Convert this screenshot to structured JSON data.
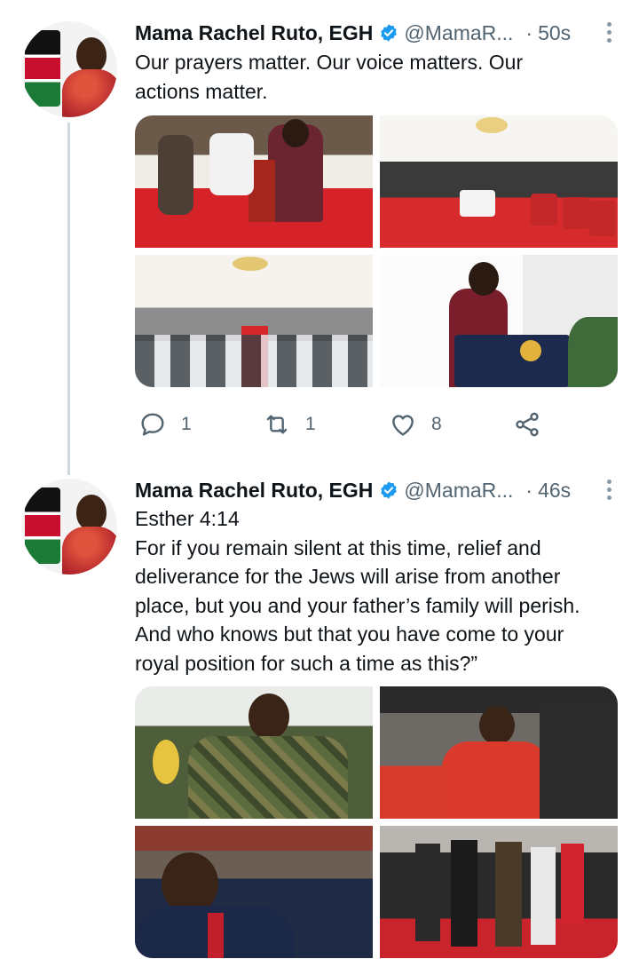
{
  "colors": {
    "verified": "#1d9bf0",
    "secondary_text": "#536471",
    "thread_line": "#cfd9de"
  },
  "tweets": [
    {
      "author": {
        "name": "Mama Rachel Ruto, EGH",
        "handle": "@MamaR...",
        "verified_icon": "verified-badge-icon"
      },
      "separator": "·",
      "time": "50s",
      "text": "Our prayers matter. Our voice matters. Our\nactions matter.",
      "actions": {
        "replies": "1",
        "retweets": "1",
        "likes": "8"
      }
    },
    {
      "author": {
        "name": "Mama Rachel Ruto, EGH",
        "handle": "@MamaR...",
        "verified_icon": "verified-badge-icon"
      },
      "separator": "·",
      "time": "46s",
      "text": "Esther 4:14\nFor if you remain silent at this time, relief and\ndeliverance for the Jews will arise from another\nplace, but you and your father’s family will perish.\nAnd who knows but that you have come to your\nroyal position for such a time as this?”"
    }
  ]
}
